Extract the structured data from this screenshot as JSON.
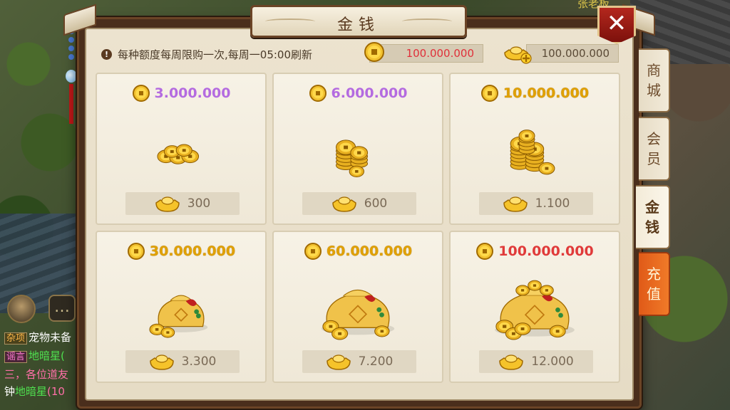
{
  "scene": {
    "npc_name": "张老板",
    "chat": {
      "lines": [
        {
          "tag": "杂项",
          "text": "宠物未备"
        },
        {
          "tag": "谣言",
          "text": "地暗星(",
          "text_color": "#4fe04f"
        },
        {
          "text": "三，各位道友"
        },
        {
          "prefix": "钟",
          "name": "地暗星",
          "suffix": "(10"
        }
      ]
    }
  },
  "panel": {
    "title": "金钱",
    "notice": "每种额度每周限购一次,每周一05:00刷新",
    "balance_coins": "100.000.000",
    "balance_gold": "100.000.000",
    "items": [
      {
        "coins": "3.000.000",
        "price_color": "purple",
        "cost": "300",
        "art": "coins-small"
      },
      {
        "coins": "6.000.000",
        "price_color": "purple",
        "cost": "600",
        "art": "coins-stack"
      },
      {
        "coins": "10.000.000",
        "price_color": "gold",
        "cost": "1.100",
        "art": "coins-stacks"
      },
      {
        "coins": "30.000.000",
        "price_color": "gold",
        "cost": "3.300",
        "art": "bag-small"
      },
      {
        "coins": "60.000.000",
        "price_color": "gold",
        "cost": "7.200",
        "art": "bag-medium"
      },
      {
        "coins": "100.000.000",
        "price_color": "red",
        "cost": "12.000",
        "art": "bag-large"
      }
    ]
  },
  "tabs": [
    {
      "label_top": "商",
      "label_bottom": "城",
      "id": "shop"
    },
    {
      "label_top": "会",
      "label_bottom": "员",
      "id": "member"
    },
    {
      "label_top": "金",
      "label_bottom": "钱",
      "id": "money",
      "active": true
    },
    {
      "label_top": "充",
      "label_bottom": "值",
      "id": "recharge"
    }
  ],
  "colors": {
    "accent_red": "#e03a3a",
    "gold": "#e0a000",
    "purple": "#b46be0"
  }
}
